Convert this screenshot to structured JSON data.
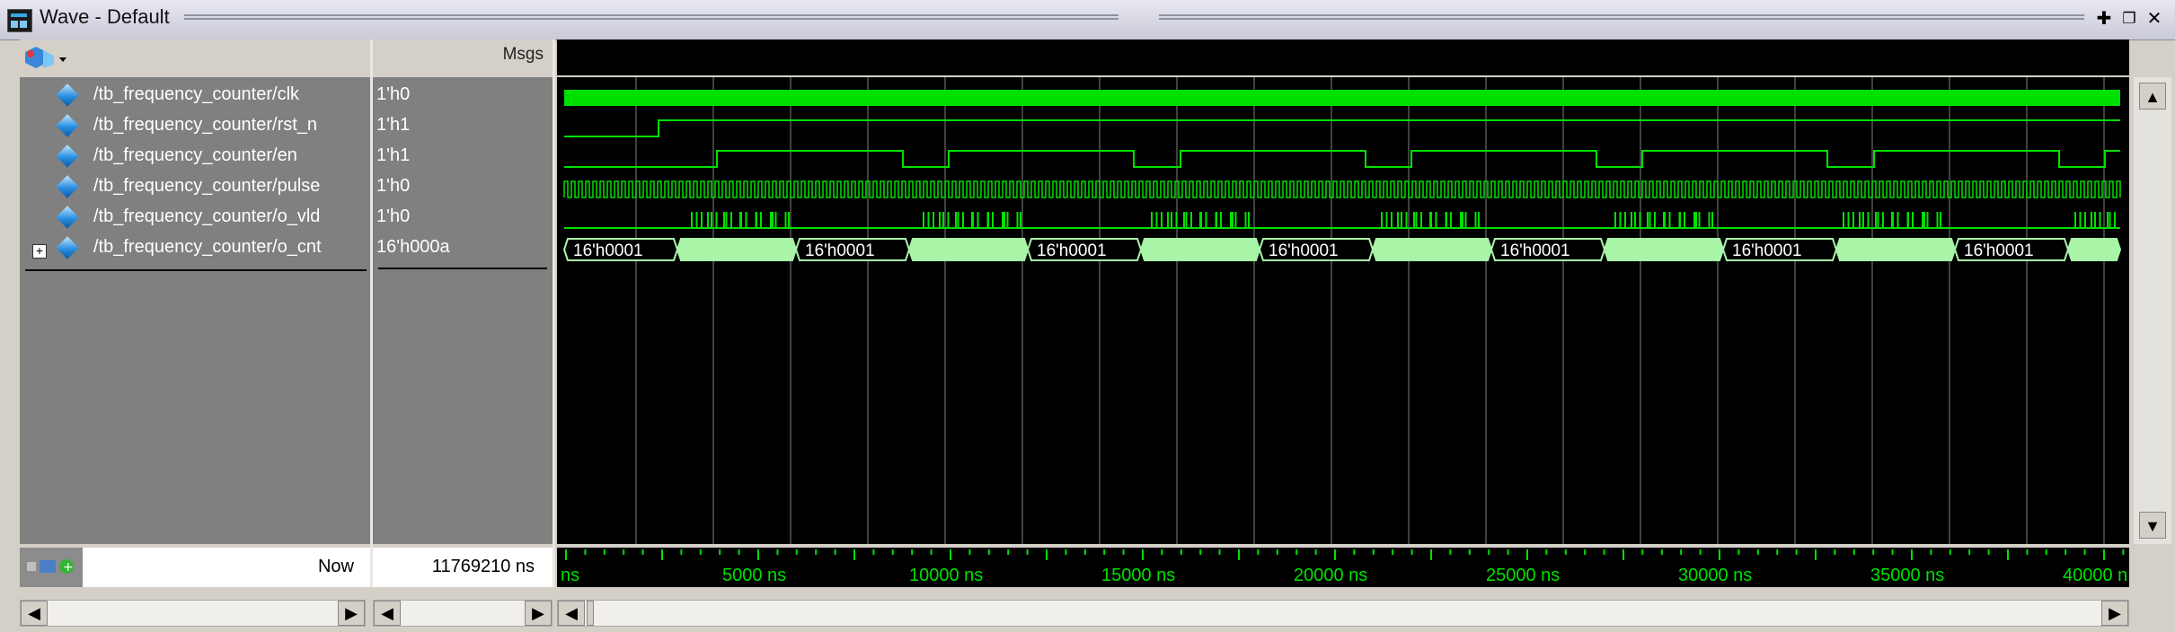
{
  "window": {
    "title": "Wave - Default"
  },
  "header": {
    "msgs_label": "Msgs"
  },
  "signals": [
    {
      "name": "/tb_frequency_counter/clk",
      "value": "1'h0"
    },
    {
      "name": "/tb_frequency_counter/rst_n",
      "value": "1'h1"
    },
    {
      "name": "/tb_frequency_counter/en",
      "value": "1'h1"
    },
    {
      "name": "/tb_frequency_counter/pulse",
      "value": "1'h0"
    },
    {
      "name": "/tb_frequency_counter/o_vld",
      "value": "1'h0"
    },
    {
      "name": "/tb_frequency_counter/o_cnt",
      "value": "16'h000a"
    }
  ],
  "bus_label": "16'h0001",
  "footer": {
    "now_label": "Now",
    "now_value": "11769210 ns"
  },
  "timeline": {
    "unit_label": "ns",
    "ticks": [
      "5000 ns",
      "10000 ns",
      "15000 ns",
      "20000 ns",
      "25000 ns",
      "30000 ns",
      "35000 ns",
      "40000 n"
    ]
  },
  "colors": {
    "wave": "#00e000",
    "bus_fill": "#a8f5a8",
    "grid": "#555555"
  },
  "icons": {
    "add_wave": "wave-add-icon",
    "close": "close-icon",
    "undock": "undock-icon",
    "maximize": "plus-icon"
  }
}
